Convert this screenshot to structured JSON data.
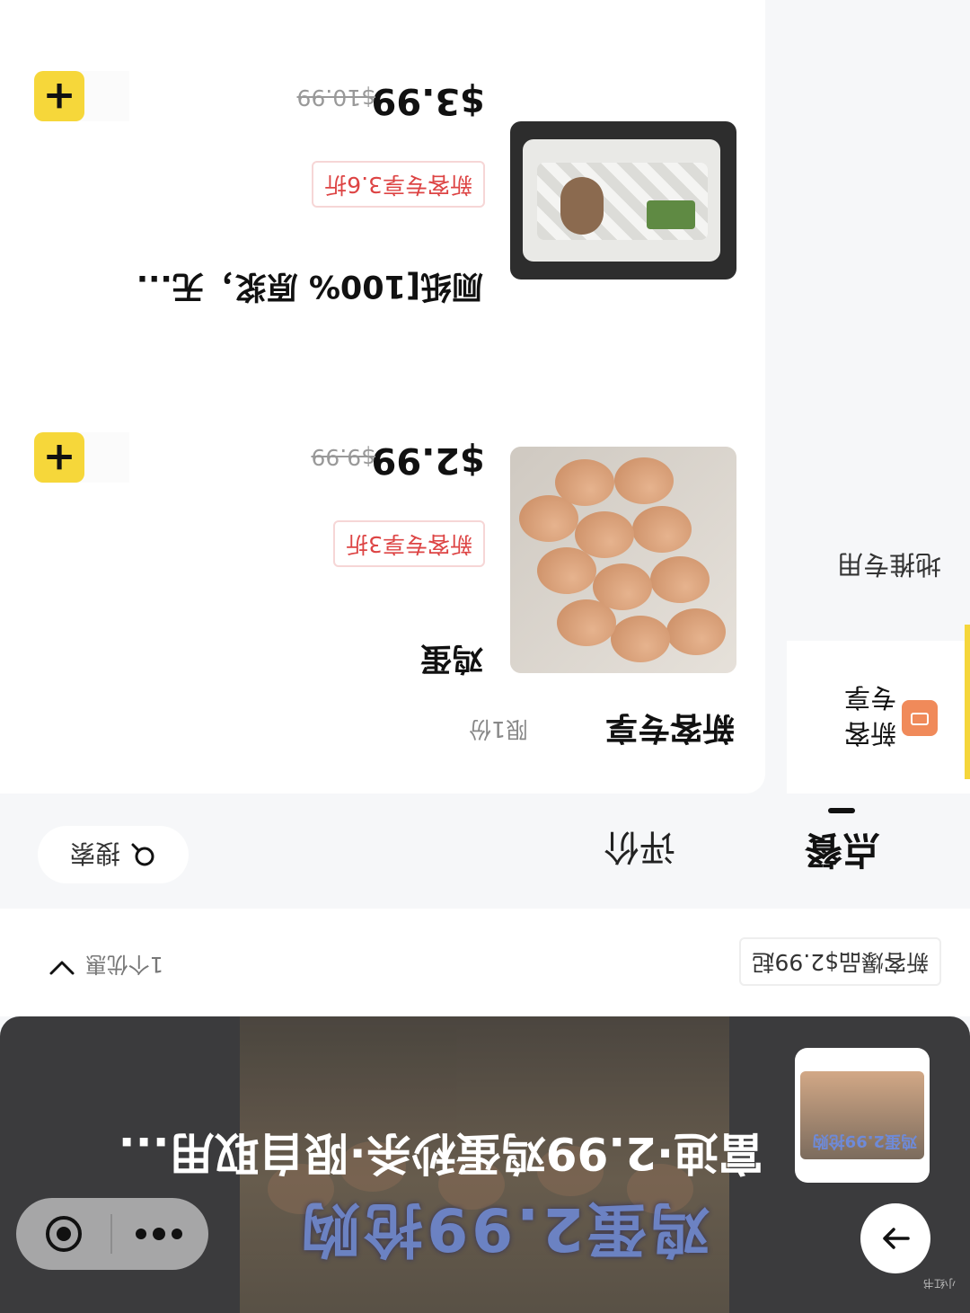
{
  "header": {
    "store_title": "富迪·2.99鸡蛋秒杀·限自取用...",
    "hero_caption": "鸡蛋2.99抢购",
    "thumb_caption": "鸡蛋2.99抢购",
    "back_icon": "arrow-right-icon",
    "capsule_icons": [
      "more-dots-icon",
      "target-record-icon"
    ]
  },
  "promo": {
    "tag": "新客爆品$2.99起",
    "count": "1个优惠"
  },
  "tabs": {
    "order": "点餐",
    "review": "评价",
    "search": "搜索"
  },
  "sidebar": {
    "active_category": "新客专享",
    "category_2": "地推专用"
  },
  "section": {
    "title": "新客专享",
    "limit": "限1份"
  },
  "products": [
    {
      "name": "鸡蛋",
      "discount_tag": "新客专享3折",
      "price": "$2.99",
      "original_price": "$9.99",
      "add_label": "+"
    },
    {
      "name": "厕纸[100% 原浆，无...",
      "discount_tag": "新客专享3.6折",
      "price": "$3.99",
      "original_price": "$10.99",
      "add_label": "+"
    }
  ],
  "colors": {
    "accent_yellow": "#f6d73a",
    "discount_red": "#dd4444",
    "header_dark": "#3b3b3d",
    "category_icon": "#f08a5a"
  },
  "watermark": "小红书"
}
